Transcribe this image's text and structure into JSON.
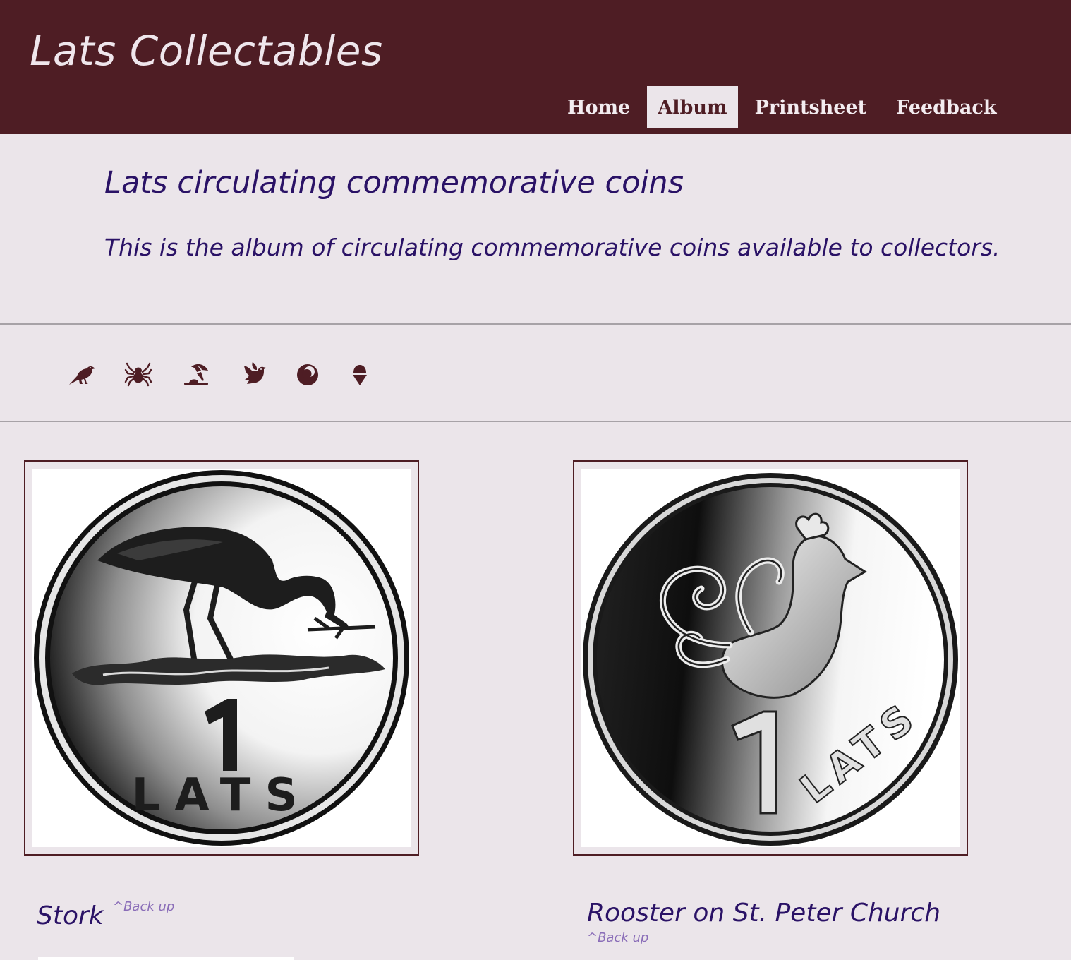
{
  "site": {
    "title": "Lats Collectables"
  },
  "nav": {
    "items": [
      {
        "label": "Home",
        "active": false
      },
      {
        "label": "Album",
        "active": true
      },
      {
        "label": "Printsheet",
        "active": false
      },
      {
        "label": "Feedback",
        "active": false
      }
    ]
  },
  "intro": {
    "heading": "Lats circulating commemorative coins",
    "text": "This is the album of circulating commemorative coins available to collectors."
  },
  "category_icons": [
    {
      "icon": "crow-icon"
    },
    {
      "icon": "spider-icon"
    },
    {
      "icon": "umbrella-beach-icon"
    },
    {
      "icon": "dove-icon"
    },
    {
      "icon": "moon-circle-icon"
    },
    {
      "icon": "ice-cream-icon"
    }
  ],
  "coins": [
    {
      "title": "Stork",
      "back_link": "^Back up",
      "image": "stork-1-lats-coin"
    },
    {
      "title": "Rooster on St. Peter Church",
      "back_link": "^Back up",
      "image": "rooster-1-lats-coin"
    }
  ],
  "colors": {
    "header_bg": "#4e1d24",
    "page_bg": "#ebe5ea",
    "heading_text": "#2a1266",
    "icon": "#4e1d24",
    "back_link": "#8a6db8"
  }
}
